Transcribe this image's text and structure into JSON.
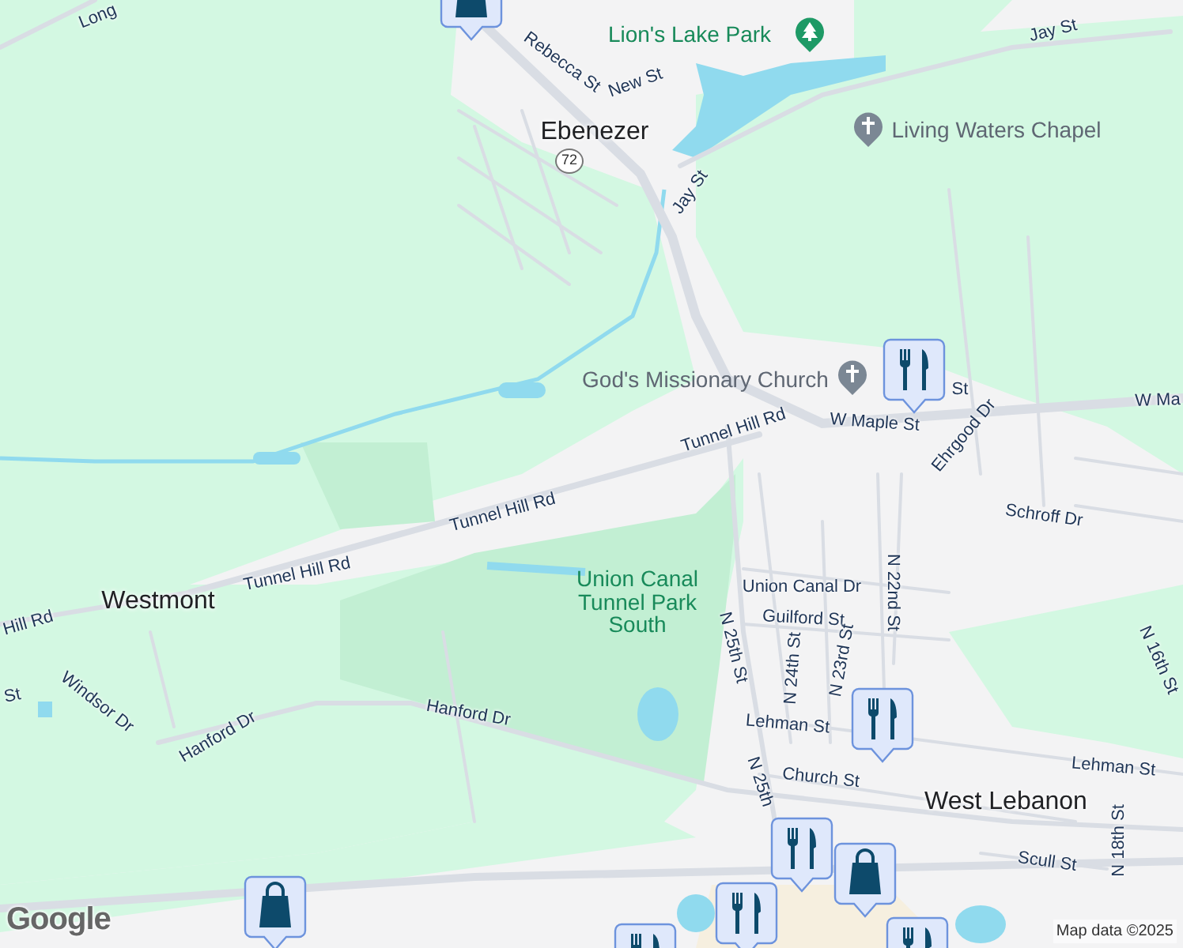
{
  "map": {
    "places": [
      {
        "label": "Ebenezer"
      },
      {
        "label": "Westmont"
      },
      {
        "label": "West Lebanon"
      }
    ],
    "route_shield": {
      "label": "72"
    },
    "pois": [
      {
        "kind": "park",
        "label": "Lion's Lake Park"
      },
      {
        "kind": "church",
        "label": "Living Waters Chapel"
      },
      {
        "kind": "church",
        "label": "God's Missionary Church"
      },
      {
        "kind": "park",
        "label": "Union Canal Tunnel Park South"
      }
    ],
    "streets": [
      {
        "label": "Long"
      },
      {
        "label": "Rebecca St"
      },
      {
        "label": "New St"
      },
      {
        "label": "Jay St"
      },
      {
        "label": "Jay St"
      },
      {
        "label": "St"
      },
      {
        "label": "W Maple St"
      },
      {
        "label": "W Ma"
      },
      {
        "label": "Tunnel Hill Rd"
      },
      {
        "label": "Tunnel Hill Rd"
      },
      {
        "label": "Tunnel Hill Rd"
      },
      {
        "label": "Hill Rd"
      },
      {
        "label": "St"
      },
      {
        "label": "Windsor Dr"
      },
      {
        "label": "Hanford Dr"
      },
      {
        "label": "Hanford Dr"
      },
      {
        "label": "Ehrgood Dr"
      },
      {
        "label": "Schroff Dr"
      },
      {
        "label": "Union Canal Dr"
      },
      {
        "label": "Guilford St"
      },
      {
        "label": "N 22nd St"
      },
      {
        "label": "N 25th St"
      },
      {
        "label": "N 24th St"
      },
      {
        "label": "N 23rd St"
      },
      {
        "label": "Lehman St"
      },
      {
        "label": "Lehman St"
      },
      {
        "label": "Church St"
      },
      {
        "label": "N 25th"
      },
      {
        "label": "N 16th St"
      },
      {
        "label": "N 18th St"
      },
      {
        "label": "Scull St"
      }
    ],
    "markers": [
      {
        "kind": "restaurant"
      },
      {
        "kind": "restaurant"
      },
      {
        "kind": "restaurant"
      },
      {
        "kind": "shopping"
      },
      {
        "kind": "shopping"
      },
      {
        "kind": "restaurant"
      },
      {
        "kind": "shopping"
      },
      {
        "kind": "restaurant"
      },
      {
        "kind": "restaurant"
      }
    ],
    "attribution": "Map data ©2025",
    "logo": "Google"
  }
}
